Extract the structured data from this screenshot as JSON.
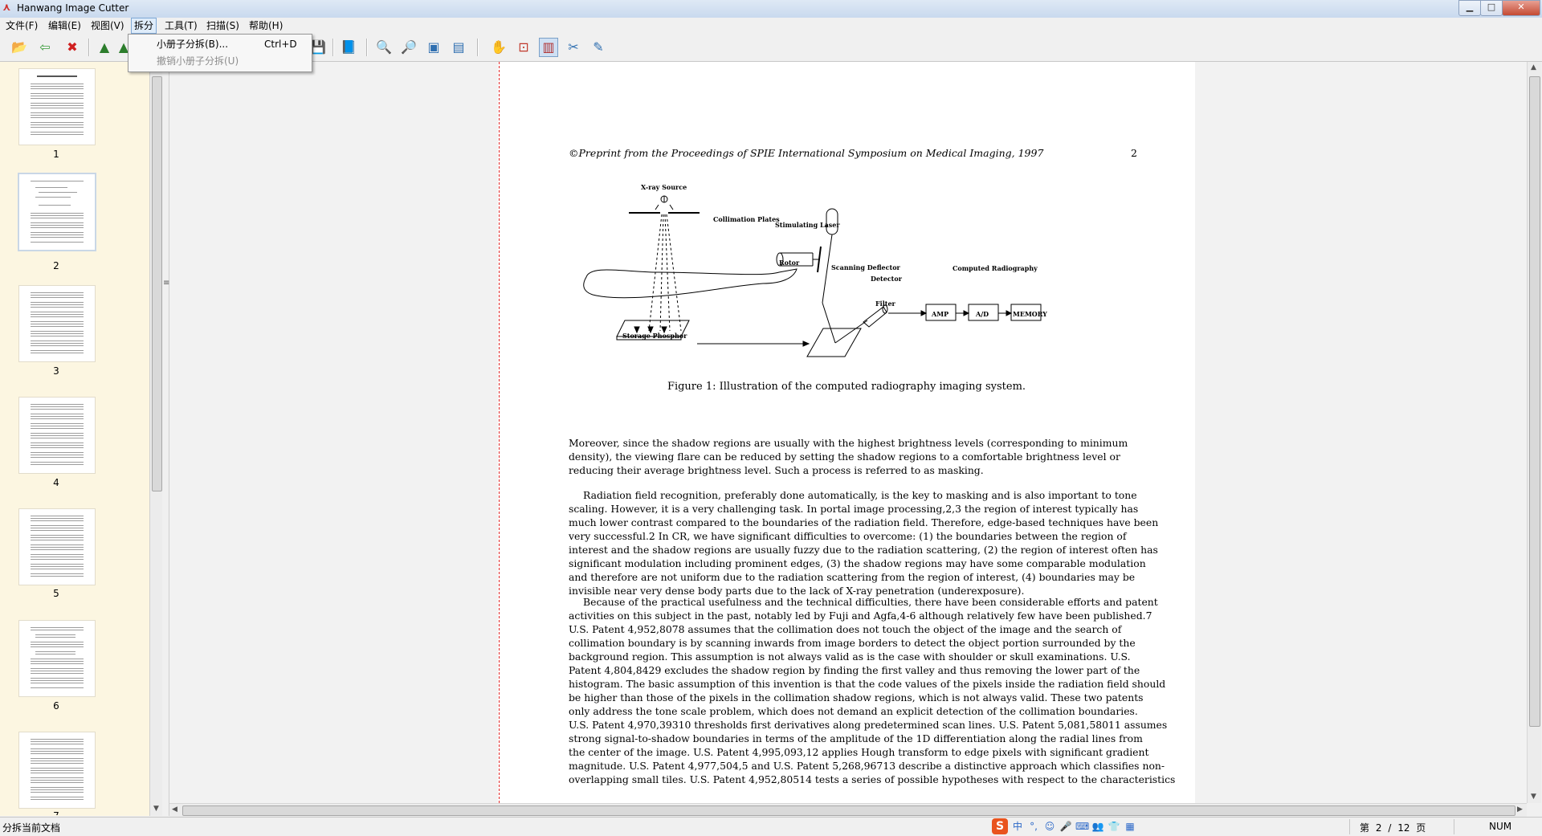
{
  "window": {
    "title": "Hanwang Image Cutter",
    "icon": "app-logo-icon",
    "controls": [
      "minimize-icon",
      "maximize-icon",
      "close-icon"
    ]
  },
  "menu": {
    "items": [
      "文件(F)",
      "编辑(E)",
      "视图(V)",
      "拆分",
      "工具(T)",
      "扫描(S)",
      "帮助(H)"
    ],
    "active": "拆分"
  },
  "dropdown": {
    "items": [
      {
        "label": "小册子分拆(B)...",
        "shortcut": "Ctrl+D",
        "enabled": true
      },
      {
        "label": "撤销小册子分拆(U)",
        "shortcut": "",
        "enabled": false
      }
    ]
  },
  "toolbar": {
    "buttons": [
      "open-icon",
      "back-icon",
      "delete-icon",
      "rotate-left-icon",
      "rotate-right-icon",
      "save-icon",
      "book-icon",
      "zoom-in-icon",
      "zoom-out-icon",
      "fit-page-icon",
      "fit-width-icon",
      "hand-icon",
      "select-icon",
      "split-view-icon",
      "scissors-icon",
      "pen-icon"
    ],
    "pressed": "split-view-icon"
  },
  "thumbnails": {
    "pages": [
      "1",
      "2",
      "3",
      "4",
      "5",
      "6",
      "7"
    ],
    "selected": "2"
  },
  "document": {
    "running_head": "Preprint from the Proceedings of SPIE International Symposium on Medical Imaging, 1997",
    "copyright_symbol": "©",
    "page_number": "2",
    "figure_labels": {
      "xray": "X-ray Source",
      "collimation": "Collimation Plates",
      "laser": "Stimulating Laser",
      "rotor": "Rotor",
      "deflector": "Scanning Deflector",
      "detector": "Detector",
      "filter": "Filter",
      "phosphor": "Storage Phosphor",
      "computed": "Computed Radiography",
      "amp": "AMP",
      "ad": "A/D",
      "memory": "MEMORY"
    },
    "caption": "Figure 1: Illustration of the computed radiography imaging system.",
    "para1": [
      "Moreover, since the shadow regions are usually with the highest brightness levels (corresponding to minimum",
      "density), the viewing flare can be reduced by setting the shadow regions to a comfortable brightness level or",
      "reducing their average brightness level. Such a process is referred to as masking."
    ],
    "para2": [
      "Radiation field recognition, preferably done automatically, is the key to masking and is also important to tone",
      "scaling. However, it is a very challenging task. In portal image processing,2,3 the region of interest typically has",
      "much lower contrast compared to the boundaries of the radiation field. Therefore, edge-based techniques have been",
      "very successful.2 In CR, we have significant difficulties to overcome: (1) the boundaries between the region of",
      "interest and the shadow regions are usually fuzzy due to the radiation scattering, (2) the region of interest often has",
      "significant modulation including prominent edges, (3) the shadow regions may have some comparable modulation",
      "and therefore are not uniform due to the radiation scattering from the region of interest, (4) boundaries may be",
      "invisible near very dense body parts due to the lack of X-ray penetration (underexposure)."
    ],
    "para3": [
      "Because of the practical usefulness and the technical difficulties, there have been considerable efforts and patent",
      "activities on this subject in the past, notably led by Fuji and Agfa,4-6 although relatively few have been published.7",
      "U.S. Patent 4,952,8078 assumes that the collimation does not touch the object of the image and the search of",
      "collimation boundary is by scanning inwards from image borders to detect the object portion surrounded by the",
      "background region. This assumption is not always valid as is the case with shoulder or skull examinations. U.S.",
      "Patent 4,804,8429 excludes the shadow region by finding the first valley and thus removing the lower part of the",
      "histogram. The basic assumption of this invention is that the code values of the pixels inside the radiation field should",
      "be higher than those of the pixels in the collimation shadow regions, which is not always valid. These two patents",
      "only address the tone scale problem, which does not demand an explicit detection of the collimation boundaries.",
      "U.S. Patent 4,970,39310 thresholds first derivatives along predetermined scan lines. U.S. Patent 5,081,58011 assumes",
      "strong signal-to-shadow boundaries in terms of the amplitude of the 1D differentiation along the radial lines from",
      "the center of the image. U.S. Patent 4,995,093,12 applies Hough transform to edge pixels with significant gradient",
      "magnitude. U.S. Patent 4,977,504,5 and U.S. Patent 5,268,96713 describe a distinctive approach which classifies non-",
      "overlapping small tiles. U.S. Patent 4,952,80514 tests a series of possible hypotheses with respect to the characteristics"
    ]
  },
  "status": {
    "message": "分拆当前文档",
    "page_label": "第",
    "current_page": "2",
    "separator": "/",
    "total_pages": "12",
    "page_suffix": "页",
    "num_lock": "NUM"
  },
  "ime": {
    "logo": "S",
    "lang": "中",
    "punct": "°,",
    "icons": [
      "emoji-icon",
      "microphone-icon",
      "keyboard-icon",
      "user-icon",
      "shirt-icon",
      "grid-icon"
    ]
  },
  "colors": {
    "thumb_bg": "#fcf6e1",
    "cut_line": "#e02828",
    "ime_logo": "#e9541e"
  }
}
